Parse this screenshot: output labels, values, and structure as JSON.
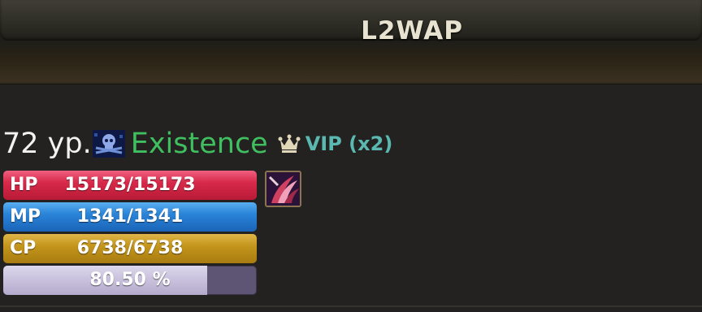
{
  "header": {
    "title": "L2WAP"
  },
  "character": {
    "level_text": "72 ур.",
    "clan_emblem_icon": "clan-emblem-icon",
    "name": "Existence",
    "name_color": "#3fbf5f",
    "vip_icon": "crown-icon",
    "vip_label": "VIP (x2)",
    "vip_color": "#5bb8b0"
  },
  "stats": {
    "hp": {
      "label": "HP",
      "value": "15173/15173",
      "fraction": 1.0,
      "color": "#d82a4a"
    },
    "mp": {
      "label": "MP",
      "value": "1341/1341",
      "fraction": 1.0,
      "color": "#2a84d8"
    },
    "cp": {
      "label": "CP",
      "value": "6738/6738",
      "fraction": 1.0,
      "color": "#c4961c"
    },
    "exp": {
      "value": "80.50 %",
      "fraction": 0.805,
      "color": "#c8c0dc"
    }
  },
  "buffs": [
    {
      "icon": "buff-claw-icon"
    }
  ]
}
